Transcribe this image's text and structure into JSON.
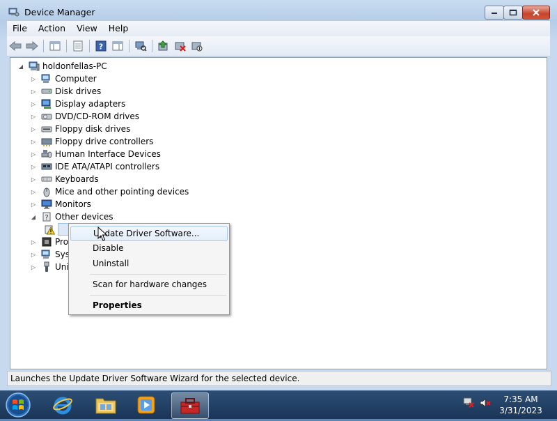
{
  "window": {
    "title": "Device Manager"
  },
  "menu": [
    "File",
    "Action",
    "View",
    "Help"
  ],
  "tree": {
    "root": "holdonfellas-PC",
    "items": [
      "Computer",
      "Disk drives",
      "Display adapters",
      "DVD/CD-ROM drives",
      "Floppy disk drives",
      "Floppy drive controllers",
      "Human Interface Devices",
      "IDE ATA/ATAPI controllers",
      "Keyboards",
      "Mice and other pointing devices",
      "Monitors",
      "Other devices",
      "Proc",
      "Syst",
      "Univ"
    ]
  },
  "context_menu": {
    "update": "Update Driver Software...",
    "disable": "Disable",
    "uninstall": "Uninstall",
    "scan": "Scan for hardware changes",
    "properties": "Properties"
  },
  "status": "Launches the Update Driver Software Wizard for the selected device.",
  "clock": {
    "time": "7:35 AM",
    "date": "3/31/2023"
  }
}
